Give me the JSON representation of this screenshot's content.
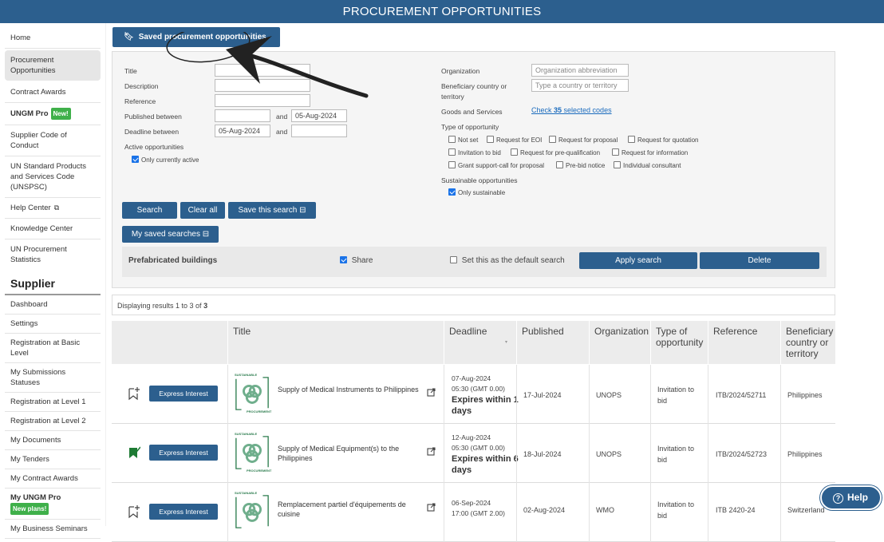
{
  "header": {
    "title": "PROCUREMENT OPPORTUNITIES"
  },
  "sidebar": {
    "items": [
      {
        "label": "Home"
      },
      {
        "label": "Procurement Opportunities"
      },
      {
        "label": "Contract Awards"
      },
      {
        "label": "UNGM Pro",
        "badge": "New!"
      },
      {
        "label": "Supplier Code of Conduct"
      },
      {
        "label": "UN Standard Products and Services Code (UNSPSC)"
      },
      {
        "label": "Help Center"
      },
      {
        "label": "Knowledge Center"
      },
      {
        "label": "UN Procurement Statistics"
      }
    ],
    "supplier_heading": "Supplier",
    "supplier_items": [
      {
        "label": "Dashboard"
      },
      {
        "label": "Settings"
      },
      {
        "label": "Registration at Basic Level"
      },
      {
        "label": "My Submissions Statuses"
      },
      {
        "label": "Registration at Level 1"
      },
      {
        "label": "Registration at Level 2"
      },
      {
        "label": "My Documents"
      },
      {
        "label": "My Tenders"
      },
      {
        "label": "My Contract Awards"
      },
      {
        "label": "My UNGM Pro",
        "badge": "New plans!"
      },
      {
        "label": "My Business Seminars"
      }
    ]
  },
  "saved_opportunities_label": "Saved procurement opportunities",
  "filters": {
    "title_label": "Title",
    "description_label": "Description",
    "reference_label": "Reference",
    "published_label": "Published between",
    "published_from": "",
    "published_to": "05-Aug-2024",
    "deadline_label": "Deadline between",
    "deadline_from": "05-Aug-2024",
    "deadline_to": "",
    "and_label": "and",
    "active_label": "Active opportunities",
    "only_active_label": "Only currently active",
    "organization_label": "Organization",
    "organization_placeholder": "Organization abbreviation",
    "beneficiary_label": "Beneficiary country or territory",
    "beneficiary_placeholder": "Type a country or territory",
    "goods_label": "Goods and Services",
    "goods_link_pre": "Check ",
    "goods_link_count": "35",
    "goods_link_post": " selected codes",
    "type_label": "Type of opportunity",
    "types": [
      "Not set",
      "Request for EOI",
      "Request for proposal",
      "Request for quotation",
      "Invitation to bid",
      "Request for pre-qualification",
      "Request for information",
      "Grant support-call for proposal",
      "Pre-bid notice",
      "Individual consultant"
    ],
    "sustainable_label": "Sustainable opportunities",
    "only_sustainable_label": "Only sustainable"
  },
  "buttons": {
    "search": "Search",
    "clear_all": "Clear all",
    "save_search": "Save this search",
    "my_saved_searches": "My saved searches",
    "apply_search": "Apply search",
    "delete": "Delete",
    "express_interest": "Express Interest",
    "help": "Help"
  },
  "saved_search": {
    "name": "Prefabricated buildings",
    "share_label": "Share",
    "default_label": "Set this as the default search"
  },
  "results": {
    "pre": "Displaying results 1 to 3 of ",
    "total": "3"
  },
  "table": {
    "columns": [
      "Title",
      "Deadline",
      "Published",
      "Organization",
      "Type of opportunity",
      "Reference",
      "Beneficiary country or territory"
    ],
    "logo_top": "SUSTAINABLE",
    "logo_bottom": "PROCUREMENT",
    "rows": [
      {
        "title": "Supply of Medical Instruments to Philippines",
        "deadline_date": "07-Aug-2024",
        "deadline_time": "05:30 (GMT 0.00)",
        "expires": "Expires within 1 days",
        "published": "17-Jul-2024",
        "organization": "UNOPS",
        "type": "Invitation to bid",
        "reference": "ITB/2024/52711",
        "country": "Philippines",
        "saved": false
      },
      {
        "title": "Supply of Medical Equipment(s) to the Philippines",
        "deadline_date": "12-Aug-2024",
        "deadline_time": "05:30 (GMT 0.00)",
        "expires": "Expires within 6 days",
        "published": "18-Jul-2024",
        "organization": "UNOPS",
        "type": "Invitation to bid",
        "reference": "ITB/2024/52723",
        "country": "Philippines",
        "saved": true
      },
      {
        "title": "Remplacement partiel d'équipements de cuisine",
        "deadline_date": "06-Sep-2024",
        "deadline_time": "17:00 (GMT 2.00)",
        "expires": "",
        "published": "02-Aug-2024",
        "organization": "WMO",
        "type": "Invitation to bid",
        "reference": "ITB 2420-24",
        "country": "Switzerland",
        "saved": false
      }
    ]
  },
  "colors": {
    "brand": "#2c5f8e",
    "saved_green": "#1e7b34",
    "link": "#1a6bbd"
  }
}
